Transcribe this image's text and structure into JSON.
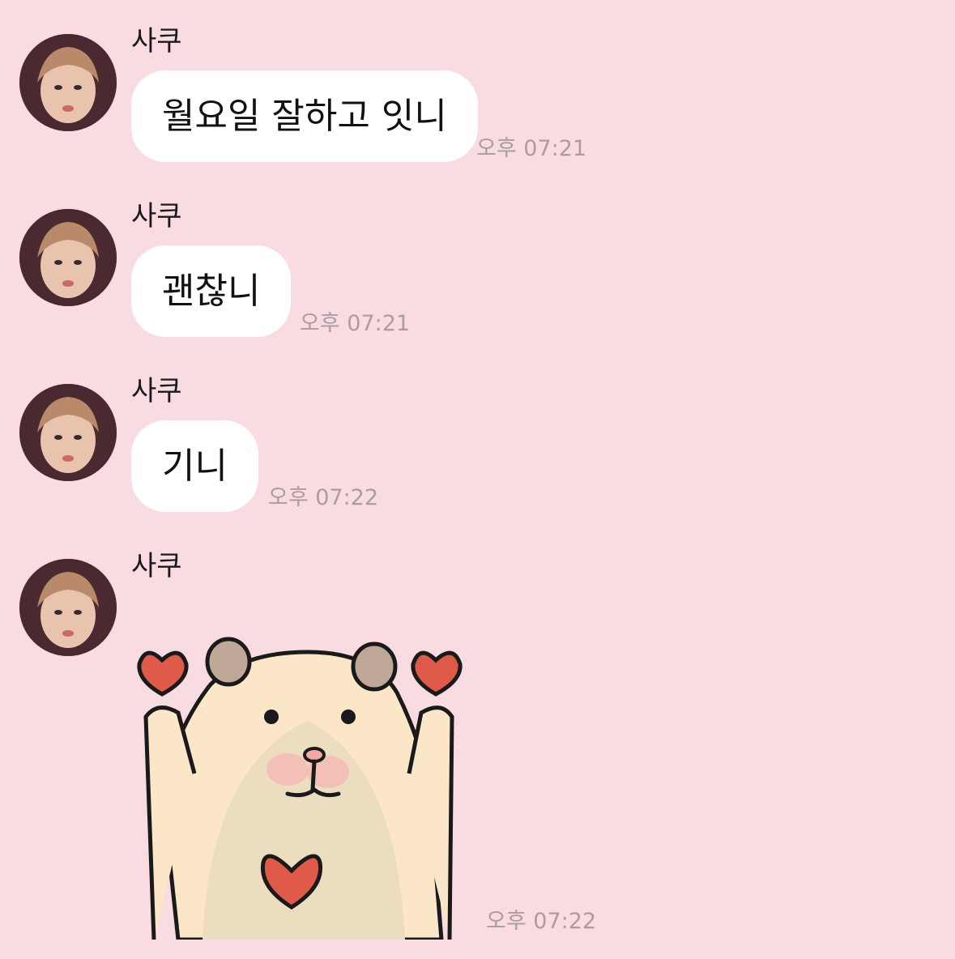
{
  "messages": [
    {
      "sender": "사쿠",
      "text": "월요일 잘하고 잇니",
      "time": "오후 07:21"
    },
    {
      "sender": "사쿠",
      "text": "괜찮니",
      "time": "오후 07:21"
    },
    {
      "sender": "사쿠",
      "text": "기니",
      "time": "오후 07:22"
    },
    {
      "sender": "사쿠",
      "sticker": "hamster-hearts-sticker",
      "time": "오후 07:22"
    }
  ]
}
